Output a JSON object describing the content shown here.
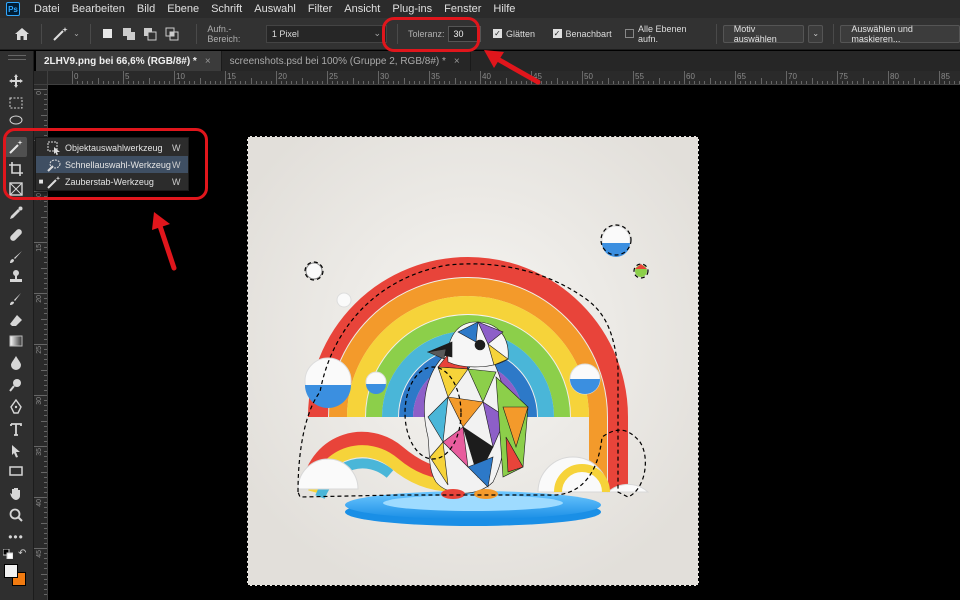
{
  "menubar": {
    "logo": "Ps",
    "items": [
      "Datei",
      "Bearbeiten",
      "Bild",
      "Ebene",
      "Schrift",
      "Auswahl",
      "Filter",
      "Ansicht",
      "Plug-ins",
      "Fenster",
      "Hilfe"
    ]
  },
  "options": {
    "sample_label": "Aufn.-Bereich:",
    "sample_value": "1 Pixel",
    "tolerance_label": "Toleranz:",
    "tolerance_value": "30",
    "antialias_label": "Glätten",
    "antialias_checked": true,
    "contiguous_label": "Benachbart",
    "contiguous_checked": true,
    "all_layers_label": "Alle Ebenen aufn.",
    "all_layers_checked": false,
    "subject_button": "Motiv auswählen",
    "select_mask_button": "Auswählen und maskieren..."
  },
  "tabs": [
    {
      "label": "2LHV9.png bei 66,6% (RGB/8#) *",
      "active": true
    },
    {
      "label": "screenshots.psd bei 100% (Gruppe 2, RGB/8#) *",
      "active": false
    }
  ],
  "flyout": {
    "items": [
      {
        "label": "Objektauswahlwerkzeug",
        "key": "W",
        "icon": "object-selection-icon",
        "current": false,
        "highlighted": false
      },
      {
        "label": "Schnellauswahl-Werkzeug",
        "key": "W",
        "icon": "quick-selection-icon",
        "current": false,
        "highlighted": true
      },
      {
        "label": "Zauberstab-Werkzeug",
        "key": "W",
        "icon": "magic-wand-icon",
        "current": true,
        "highlighted": false
      }
    ]
  },
  "ruler_h": [
    "0",
    "5",
    "10",
    "15",
    "20",
    "25",
    "30",
    "35",
    "40",
    "45",
    "50",
    "55",
    "60",
    "65",
    "70",
    "75",
    "80",
    "85",
    "90"
  ],
  "ruler_v": [
    "0",
    "5",
    "10",
    "15",
    "20",
    "25",
    "30",
    "35",
    "40",
    "45"
  ],
  "colors": {
    "annotation": "#e0161c",
    "foreground": "#f2f2f2",
    "background": "#f07a10"
  },
  "tools": [
    "move-icon",
    "marquee-icon",
    "lasso-icon",
    "magic-wand-icon",
    "crop-icon",
    "frame-icon",
    "eyedropper-icon",
    "healing-brush-icon",
    "brush-icon",
    "stamp-icon",
    "history-brush-icon",
    "eraser-icon",
    "gradient-icon",
    "blur-icon",
    "dodge-icon",
    "pen-icon",
    "type-icon",
    "path-selection-icon",
    "rectangle-icon",
    "hand-icon",
    "zoom-icon",
    "more-tools-icon"
  ]
}
